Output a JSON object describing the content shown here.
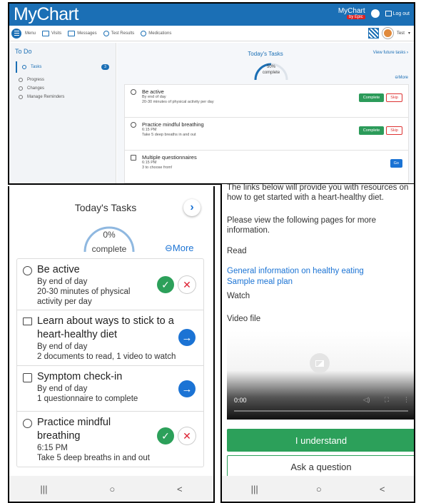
{
  "desktop": {
    "brand": "MyChart",
    "epic_mychart": "MyChart",
    "epic_by": "by Epic",
    "logout": "Log out",
    "nav": {
      "menu": "Menu",
      "visits": "Visits",
      "messages": "Messages",
      "test_results": "Test Results",
      "medications": "Medications",
      "user": "Test"
    },
    "sidebar": {
      "title": "To Do",
      "items": [
        {
          "label": "Tasks",
          "badge": "3"
        },
        {
          "label": "Progress"
        },
        {
          "label": "Changes"
        },
        {
          "label": "Manage Reminders"
        }
      ]
    },
    "todays_tasks": "Today's Tasks",
    "view_future": "View future tasks",
    "gauge": {
      "percent": "50%",
      "label": "complete",
      "fraction": 0.5
    },
    "more": "More",
    "tasks": [
      {
        "title": "Be active",
        "due": "By end of day",
        "detail": "20-30 minutes of physical activity per day",
        "primary": "Complete",
        "secondary": "Skip"
      },
      {
        "title": "Practice mindful breathing",
        "due": "6:15 PM",
        "detail": "Take 5 deep breaths in and out",
        "primary": "Complete",
        "secondary": "Skip"
      },
      {
        "title": "Multiple questionnaires",
        "due": "6:15 PM",
        "detail": "3 to choose from!",
        "primary": "Go"
      }
    ]
  },
  "mobile_tasks": {
    "title": "Today's Tasks",
    "gauge": {
      "percent": "0%",
      "label": "complete",
      "fraction": 0.0
    },
    "more": "More",
    "tasks": [
      {
        "title": "Be active",
        "due": "By end of day",
        "detail": "20-30 minutes of physical activity per day"
      },
      {
        "title": "Learn about ways to stick to a heart-healthy diet",
        "due": "By end of day",
        "detail": "2 documents to read, 1 video to watch"
      },
      {
        "title": "Symptom check-in",
        "due": "By end of day",
        "detail": "1 questionnaire to complete"
      },
      {
        "title": "Practice mindful breathing",
        "due": "6:15 PM",
        "detail": "Take 5 deep breaths in and out"
      }
    ]
  },
  "mobile_resource": {
    "intro": "The links below will provide you with resources on how to get started with a heart-healthy diet.",
    "view_pages": "Please view the following pages for more information.",
    "read": "Read",
    "link1": "General information on healthy eating",
    "link2": "Sample meal plan",
    "watch": "Watch",
    "video_file": "Video file",
    "video_time": "0:00",
    "understand": "I understand",
    "ask": "Ask a question"
  },
  "android_nav": {
    "recents": "|||",
    "home": "○",
    "back": "<"
  },
  "colors": {
    "brand_blue": "#1b6fb5",
    "complete_green": "#2ca05a",
    "skip_red": "#d33",
    "go_blue": "#1b73d4"
  }
}
